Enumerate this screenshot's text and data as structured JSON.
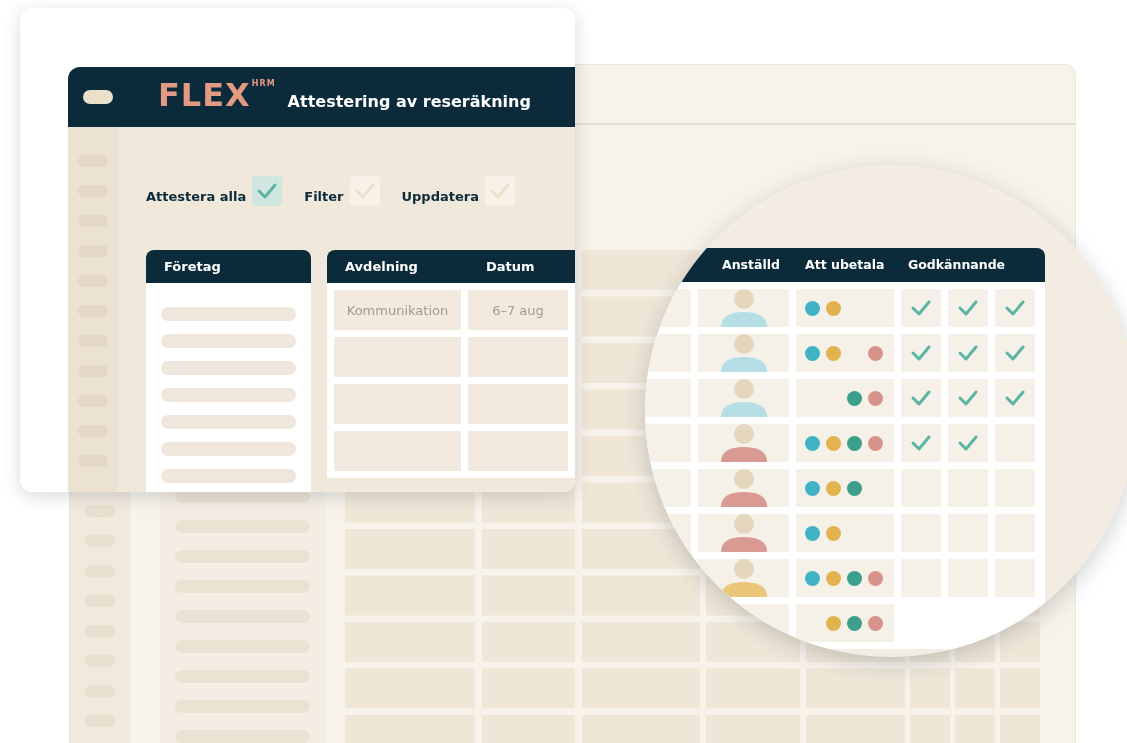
{
  "app": {
    "logo": "FLEX",
    "logo_sup": "HRM",
    "title": "Attestering av reseräkning"
  },
  "actions": [
    {
      "label": "Attestera alla",
      "checked": true
    },
    {
      "label": "Filter",
      "checked": false
    },
    {
      "label": "Uppdatera",
      "checked": false
    }
  ],
  "company_table": {
    "column": "Företag"
  },
  "department_table": {
    "columns": [
      "Avdelning",
      "Datum"
    ],
    "first_row": [
      "Kommunikation",
      "6–7 aug"
    ]
  },
  "magnified_table": {
    "columns": [
      "Anställd",
      "Att ubetala",
      "Godkännande"
    ],
    "rows": [
      {
        "avatar": {
          "color": "#b5dfe5"
        },
        "dots": [
          {
            "color": "#3fb3c4"
          },
          {
            "color": "#e2b24f"
          },
          {
            "kind": "gap"
          },
          {
            "kind": "gap"
          }
        ],
        "approvals": [
          {
            "checked": true
          },
          {
            "checked": true
          },
          {
            "checked": true
          }
        ]
      },
      {
        "avatar": {
          "color": "#b5dfe5"
        },
        "dots": [
          {
            "color": "#3fb3c4"
          },
          {
            "color": "#e2b24f"
          },
          {
            "kind": "gap"
          },
          {
            "color": "#d7928a"
          }
        ],
        "approvals": [
          {
            "checked": true
          },
          {
            "checked": true
          },
          {
            "checked": true
          }
        ]
      },
      {
        "avatar": {
          "color": "#b5dfe5"
        },
        "dots": [
          {
            "kind": "gap"
          },
          {
            "kind": "gap"
          },
          {
            "color": "#3c9f8c"
          },
          {
            "color": "#d7928a"
          }
        ],
        "approvals": [
          {
            "checked": true
          },
          {
            "checked": true
          },
          {
            "checked": true
          }
        ]
      },
      {
        "avatar": {
          "color": "#d89a92"
        },
        "dots": [
          {
            "color": "#3fb3c4"
          },
          {
            "color": "#e2b24f"
          },
          {
            "color": "#3c9f8c"
          },
          {
            "color": "#d7928a"
          }
        ],
        "approvals": [
          {
            "checked": true
          },
          {
            "checked": true
          },
          {
            "checked": false
          }
        ]
      },
      {
        "avatar": {
          "color": "#d89a92"
        },
        "dots": [
          {
            "color": "#3fb3c4"
          },
          {
            "color": "#e2b24f"
          },
          {
            "color": "#3c9f8c"
          },
          {
            "kind": "gap"
          }
        ],
        "approvals": [
          {
            "checked": false
          },
          {
            "checked": false
          },
          {
            "checked": false
          }
        ]
      },
      {
        "avatar": {
          "color": "#d89a92"
        },
        "dots": [
          {
            "color": "#3fb3c4"
          },
          {
            "color": "#e2b24f"
          },
          {
            "kind": "gap"
          },
          {
            "kind": "gap"
          }
        ],
        "approvals": [
          {
            "checked": false
          },
          {
            "checked": false
          },
          {
            "checked": false
          }
        ]
      },
      {
        "avatar": {
          "color": "#ebc679"
        },
        "dots": [
          {
            "color": "#3fb3c4"
          },
          {
            "color": "#e2b24f"
          },
          {
            "color": "#3c9f8c"
          },
          {
            "color": "#d7928a"
          }
        ],
        "approvals": [
          {
            "checked": false
          },
          {
            "checked": false
          },
          {
            "checked": false
          }
        ]
      },
      {
        "dots": [
          {
            "kind": "gap"
          },
          {
            "color": "#e2b24f"
          },
          {
            "color": "#3c9f8c"
          },
          {
            "color": "#d7928a"
          }
        ]
      }
    ]
  }
}
